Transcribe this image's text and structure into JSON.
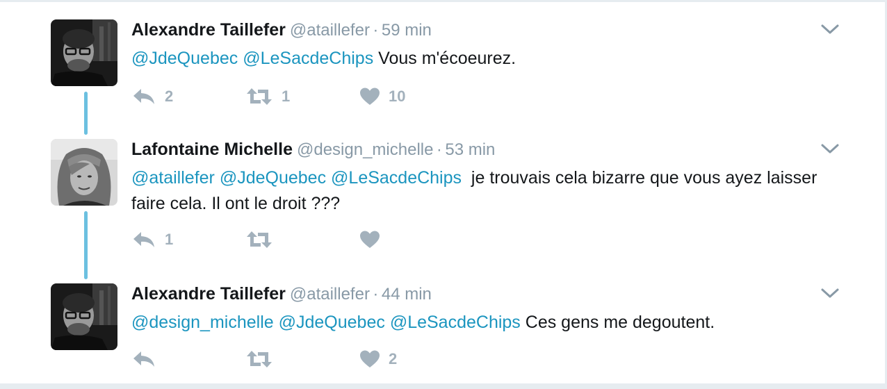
{
  "colors": {
    "mention": "#1b95bf",
    "meta": "#8899a6",
    "icon": "#a3b1bc",
    "thread_line": "#6cc0e0"
  },
  "tweets": [
    {
      "name": "Alexandre Taillefer",
      "handle": "@ataillefer",
      "separator": "·",
      "time": "59 min",
      "mentions": [
        "@JdeQuebec",
        "@LeSacdeChips"
      ],
      "text": "Vous m'écoeurez.",
      "replies": "2",
      "retweets": "1",
      "likes": "10",
      "avatar": "man-with-glasses-photo"
    },
    {
      "name": "Lafontaine Michelle",
      "handle": "@design_michelle",
      "separator": "·",
      "time": "53 min",
      "mentions": [
        "@ataillefer",
        "@JdeQuebec",
        "@LeSacdeChips"
      ],
      "text": " je trouvais cela bizarre que vous ayez laisser faire cela. Il ont le droit ???",
      "replies": "1",
      "retweets": "",
      "likes": "",
      "avatar": "woman-blonde-photo"
    },
    {
      "name": "Alexandre Taillefer",
      "handle": "@ataillefer",
      "separator": "·",
      "time": "44 min",
      "mentions": [
        "@design_michelle",
        "@JdeQuebec",
        "@LeSacdeChips"
      ],
      "text": "Ces gens me degoutent.",
      "replies": "",
      "retweets": "",
      "likes": "2",
      "avatar": "man-with-glasses-photo"
    }
  ],
  "icons": {
    "reply": "reply-icon",
    "retweet": "retweet-icon",
    "like": "heart-icon",
    "menu": "chevron-down-icon"
  }
}
